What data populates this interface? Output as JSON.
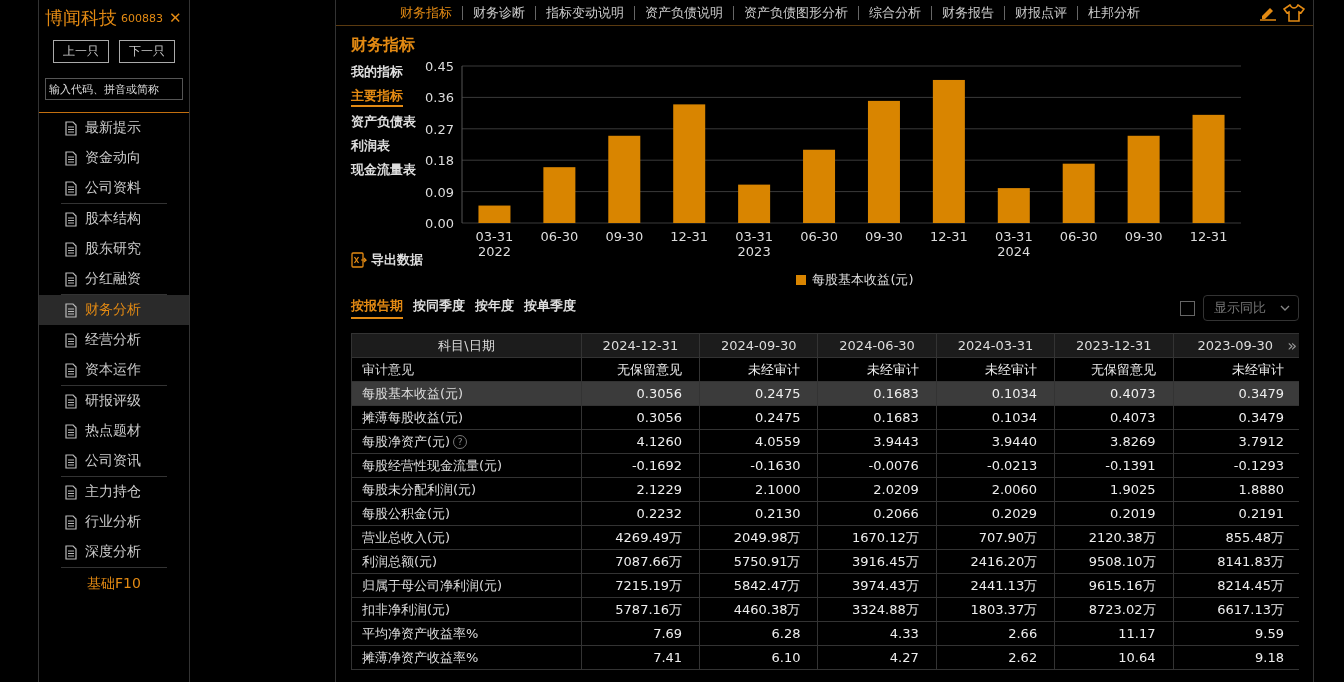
{
  "sidebar": {
    "stock_name": "博闻科技",
    "stock_code": "600883",
    "close": "✕",
    "prev_button": "上一只",
    "next_button": "下一只",
    "search": {
      "placeholder": "输入代码、拼音或简称"
    },
    "groups": [
      {
        "items": [
          {
            "label": "最新提示",
            "selected": false
          },
          {
            "label": "资金动向",
            "selected": false
          },
          {
            "label": "公司资料",
            "selected": false
          }
        ]
      },
      {
        "items": [
          {
            "label": "股本结构",
            "selected": false
          },
          {
            "label": "股东研究",
            "selected": false
          },
          {
            "label": "分红融资",
            "selected": false
          }
        ]
      },
      {
        "items": [
          {
            "label": "财务分析",
            "selected": true
          },
          {
            "label": "经营分析",
            "selected": false
          },
          {
            "label": "资本运作",
            "selected": false
          }
        ]
      },
      {
        "items": [
          {
            "label": "研报评级",
            "selected": false
          },
          {
            "label": "热点题材",
            "selected": false
          },
          {
            "label": "公司资讯",
            "selected": false
          }
        ]
      },
      {
        "items": [
          {
            "label": "主力持仓",
            "selected": false
          },
          {
            "label": "行业分析",
            "selected": false
          },
          {
            "label": "深度分析",
            "selected": false
          }
        ]
      }
    ],
    "footer_link": "基础F10"
  },
  "tabs": [
    {
      "label": "财务指标",
      "selected": true
    },
    {
      "label": "财务诊断",
      "selected": false
    },
    {
      "label": "指标变动说明",
      "selected": false
    },
    {
      "label": "资产负债说明",
      "selected": false
    },
    {
      "label": "资产负债图形分析",
      "selected": false
    },
    {
      "label": "综合分析",
      "selected": false
    },
    {
      "label": "财务报告",
      "selected": false
    },
    {
      "label": "财报点评",
      "selected": false
    },
    {
      "label": "杜邦分析",
      "selected": false
    }
  ],
  "section_title": "财务指标",
  "indicator_menu": [
    {
      "label": "我的指标",
      "selected": false
    },
    {
      "label": "主要指标",
      "selected": true
    },
    {
      "label": "资产负债表",
      "selected": false
    },
    {
      "label": "利润表",
      "selected": false
    },
    {
      "label": "现金流量表",
      "selected": false
    }
  ],
  "export_button": "导出数据",
  "chart_data": {
    "type": "bar",
    "categories": [
      "03-31\n2022",
      "06-30",
      "09-30",
      "12-31",
      "03-31\n2023",
      "06-30",
      "09-30",
      "12-31",
      "03-31\n2024",
      "06-30",
      "09-30",
      "12-31"
    ],
    "series": [
      {
        "name": "每股基本收益(元)",
        "color": "#d98500",
        "values": [
          0.05,
          0.16,
          0.25,
          0.34,
          0.11,
          0.21,
          0.35,
          0.41,
          0.1,
          0.17,
          0.25,
          0.31
        ]
      }
    ],
    "grid": true,
    "ylim": [
      0,
      0.45
    ],
    "yticks": [
      {
        "value": 0,
        "label": "0.00"
      },
      {
        "value": 0.09,
        "label": "0.09"
      },
      {
        "value": 0.18,
        "label": "0.18"
      },
      {
        "value": 0.27,
        "label": "0.27"
      },
      {
        "value": 0.36,
        "label": "0.36"
      },
      {
        "value": 0.45,
        "label": "0.45"
      }
    ]
  },
  "period_tabs": [
    {
      "label": "按报告期",
      "selected": true
    },
    {
      "label": "按同季度",
      "selected": false
    },
    {
      "label": "按年度",
      "selected": false
    },
    {
      "label": "按单季度",
      "selected": false
    }
  ],
  "compare_checkbox": {
    "checked": false
  },
  "compare_dropdown": "显示同比",
  "table": {
    "columns": [
      "科目\\日期",
      "2024-12-31",
      "2024-09-30",
      "2024-06-30",
      "2024-03-31",
      "2023-12-31",
      "2023-09-30"
    ],
    "more": "»",
    "rows": [
      {
        "selected": false,
        "cells": [
          "审计意见",
          "无保留意见",
          "未经审计",
          "未经审计",
          "未经审计",
          "无保留意见",
          "未经审计"
        ]
      },
      {
        "selected": true,
        "cells": [
          "每股基本收益(元)",
          "0.3056",
          "0.2475",
          "0.1683",
          "0.1034",
          "0.4073",
          "0.3479"
        ]
      },
      {
        "selected": false,
        "cells": [
          "摊薄每股收益(元)",
          "0.3056",
          "0.2475",
          "0.1683",
          "0.1034",
          "0.4073",
          "0.3479"
        ]
      },
      {
        "selected": false,
        "help": "?",
        "cells": [
          "每股净资产(元)",
          "4.1260",
          "4.0559",
          "3.9443",
          "3.9440",
          "3.8269",
          "3.7912"
        ]
      },
      {
        "selected": false,
        "cells": [
          "每股经营性现金流量(元)",
          "-0.1692",
          "-0.1630",
          "-0.0076",
          "-0.0213",
          "-0.1391",
          "-0.1293"
        ]
      },
      {
        "selected": false,
        "cells": [
          "每股未分配利润(元)",
          "2.1229",
          "2.1000",
          "2.0209",
          "2.0060",
          "1.9025",
          "1.8880"
        ]
      },
      {
        "selected": false,
        "cells": [
          "每股公积金(元)",
          "0.2232",
          "0.2130",
          "0.2066",
          "0.2029",
          "0.2019",
          "0.2191"
        ]
      },
      {
        "selected": false,
        "cells": [
          "营业总收入(元)",
          "4269.49万",
          "2049.98万",
          "1670.12万",
          "707.90万",
          "2120.38万",
          "855.48万"
        ]
      },
      {
        "selected": false,
        "cells": [
          "利润总额(元)",
          "7087.66万",
          "5750.91万",
          "3916.45万",
          "2416.20万",
          "9508.10万",
          "8141.83万"
        ]
      },
      {
        "selected": false,
        "cells": [
          "归属于母公司净利润(元)",
          "7215.19万",
          "5842.47万",
          "3974.43万",
          "2441.13万",
          "9615.16万",
          "8214.45万"
        ]
      },
      {
        "selected": false,
        "cells": [
          "扣非净利润(元)",
          "5787.16万",
          "4460.38万",
          "3324.88万",
          "1803.37万",
          "8723.02万",
          "6617.13万"
        ]
      },
      {
        "selected": false,
        "cells": [
          "平均净资产收益率%",
          "7.69",
          "6.28",
          "4.33",
          "2.66",
          "11.17",
          "9.59"
        ]
      },
      {
        "selected": false,
        "cells": [
          "摊薄净资产收益率%",
          "7.41",
          "6.10",
          "4.27",
          "2.62",
          "10.64",
          "9.18"
        ]
      }
    ]
  }
}
